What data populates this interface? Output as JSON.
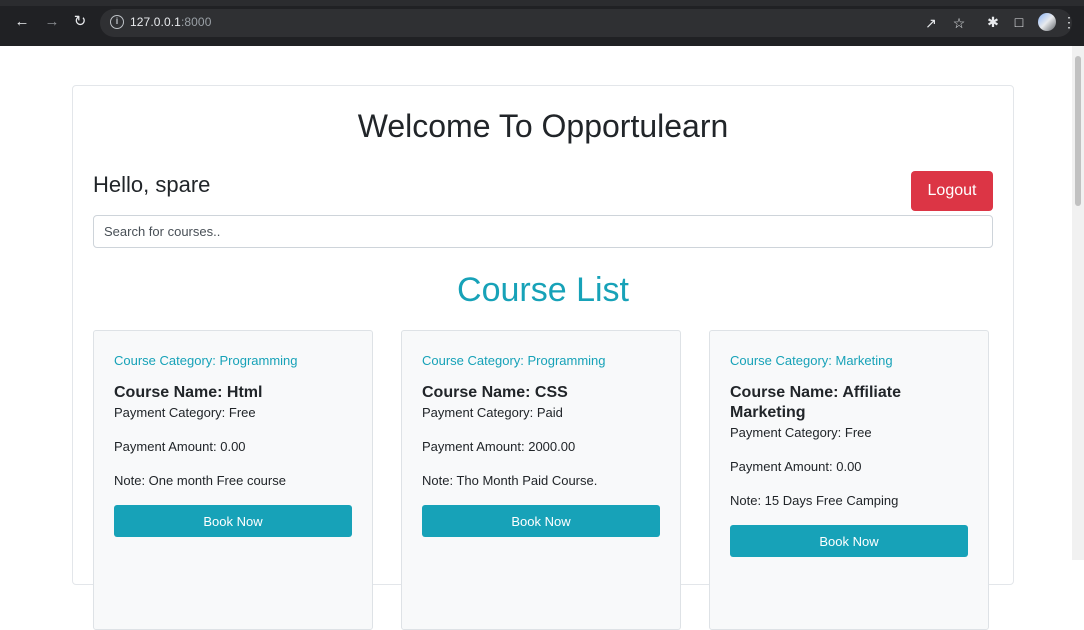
{
  "browser": {
    "url_host": "127.0.0.1",
    "url_port": ":8000",
    "icons": [
      "back-icon",
      "forward-icon",
      "reload-icon",
      "info-icon",
      "share-icon",
      "star-icon",
      "extensions-icon",
      "sidepanel-icon",
      "profile-icon",
      "menu-icon"
    ]
  },
  "header": {
    "title": "Welcome To Opportulearn",
    "greeting": "Hello, spare",
    "logout_label": "Logout"
  },
  "search": {
    "placeholder": "Search for courses.."
  },
  "course_list": {
    "title": "Course List",
    "courses": [
      {
        "category": "Course Category: Programming",
        "name": "Course Name: Html",
        "payment_category": "Payment Category: Free",
        "payment_amount": "Payment Amount: 0.00",
        "note": "Note: One month Free course",
        "button": "Book Now"
      },
      {
        "category": "Course Category: Programming",
        "name": "Course Name: CSS",
        "payment_category": "Payment Category: Paid",
        "payment_amount": "Payment Amount: 2000.00",
        "note": "Note: Tho Month Paid Course.",
        "button": "Book Now"
      },
      {
        "category": "Course Category: Marketing",
        "name": "Course Name: Affiliate Marketing",
        "payment_category": "Payment Category: Free",
        "payment_amount": "Payment Amount: 0.00",
        "note": "Note: 15 Days Free Camping",
        "button": "Book Now"
      }
    ]
  },
  "colors": {
    "accent": "#17a2b8",
    "danger": "#dc3545",
    "text": "#212529"
  }
}
